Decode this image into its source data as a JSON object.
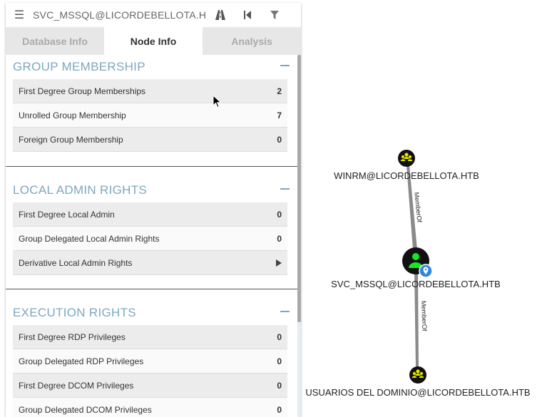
{
  "search": {
    "value": "SVC_MSSQL@LICORDEBELLOTA.H"
  },
  "tabs": [
    {
      "label": "Database Info",
      "active": false
    },
    {
      "label": "Node Info",
      "active": true
    },
    {
      "label": "Analysis",
      "active": false
    }
  ],
  "sections": [
    {
      "title": "GROUP MEMBERSHIP",
      "rows": [
        {
          "label": "First Degree Group Memberships",
          "value": "2"
        },
        {
          "label": "Unrolled Group Membership",
          "value": "7"
        },
        {
          "label": "Foreign Group Membership",
          "value": "0"
        }
      ]
    },
    {
      "title": "LOCAL ADMIN RIGHTS",
      "rows": [
        {
          "label": "First Degree Local Admin",
          "value": "0"
        },
        {
          "label": "Group Delegated Local Admin Rights",
          "value": "0"
        },
        {
          "label": "Derivative Local Admin Rights",
          "value": ""
        }
      ]
    },
    {
      "title": "EXECUTION RIGHTS",
      "rows": [
        {
          "label": "First Degree RDP Privileges",
          "value": "0"
        },
        {
          "label": "Group Delegated RDP Privileges",
          "value": "0"
        },
        {
          "label": "First Degree DCOM Privileges",
          "value": "0"
        },
        {
          "label": "Group Delegated DCOM Privileges",
          "value": "0"
        }
      ]
    }
  ],
  "graph": {
    "nodes": [
      {
        "label": "WINRM@LICORDEBELLOTA.HTB",
        "type": "group"
      },
      {
        "label": "SVC_MSSQL@LICORDEBELLOTA.HTB",
        "type": "user"
      },
      {
        "label": "USUARIOS DEL DOMINIO@LICORDEBELLOTA.HTB",
        "type": "group"
      }
    ],
    "edges": [
      {
        "label": "MemberOf"
      },
      {
        "label": "MemberOf"
      }
    ]
  },
  "colors": {
    "group_node": "#e4e500",
    "user_node": "#17e625",
    "section_title": "#7da7c1",
    "owned_marker": "#2e86de"
  }
}
